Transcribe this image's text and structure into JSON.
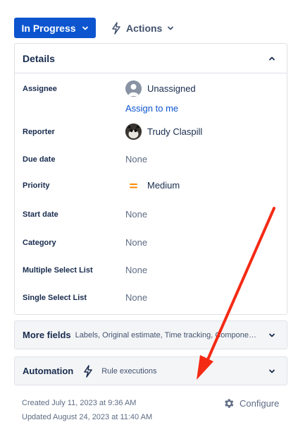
{
  "toolbar": {
    "status_label": "In Progress",
    "actions_label": "Actions"
  },
  "details": {
    "title": "Details",
    "fields": [
      {
        "label": "Assignee",
        "value": "Unassigned",
        "link": "Assign to me"
      },
      {
        "label": "Reporter",
        "value": "Trudy Claspill"
      },
      {
        "label": "Due date",
        "value": "None"
      },
      {
        "label": "Priority",
        "value": "Medium",
        "priority_color": "#ff8b00"
      },
      {
        "label": "Start date",
        "value": "None"
      },
      {
        "label": "Category",
        "value": "None"
      },
      {
        "label": "Multiple Select List",
        "value": "None"
      },
      {
        "label": "Single Select List",
        "value": "None"
      }
    ]
  },
  "more_fields": {
    "title": "More fields",
    "summary": "Labels, Original estimate, Time tracking, Compone…"
  },
  "automation": {
    "title": "Automation",
    "subtitle": "Rule executions"
  },
  "footer": {
    "created": "Created July 11, 2023 at 9:36 AM",
    "updated": "Updated August 24, 2023 at 11:40 AM",
    "configure_label": "Configure"
  },
  "colors": {
    "primary": "#0c55cf",
    "annotation_arrow": "#f42a14"
  },
  "icons": [
    "chevron-down-icon",
    "lightning-icon",
    "chevron-up-icon",
    "user-icon",
    "priority-medium-icon",
    "gear-icon"
  ]
}
